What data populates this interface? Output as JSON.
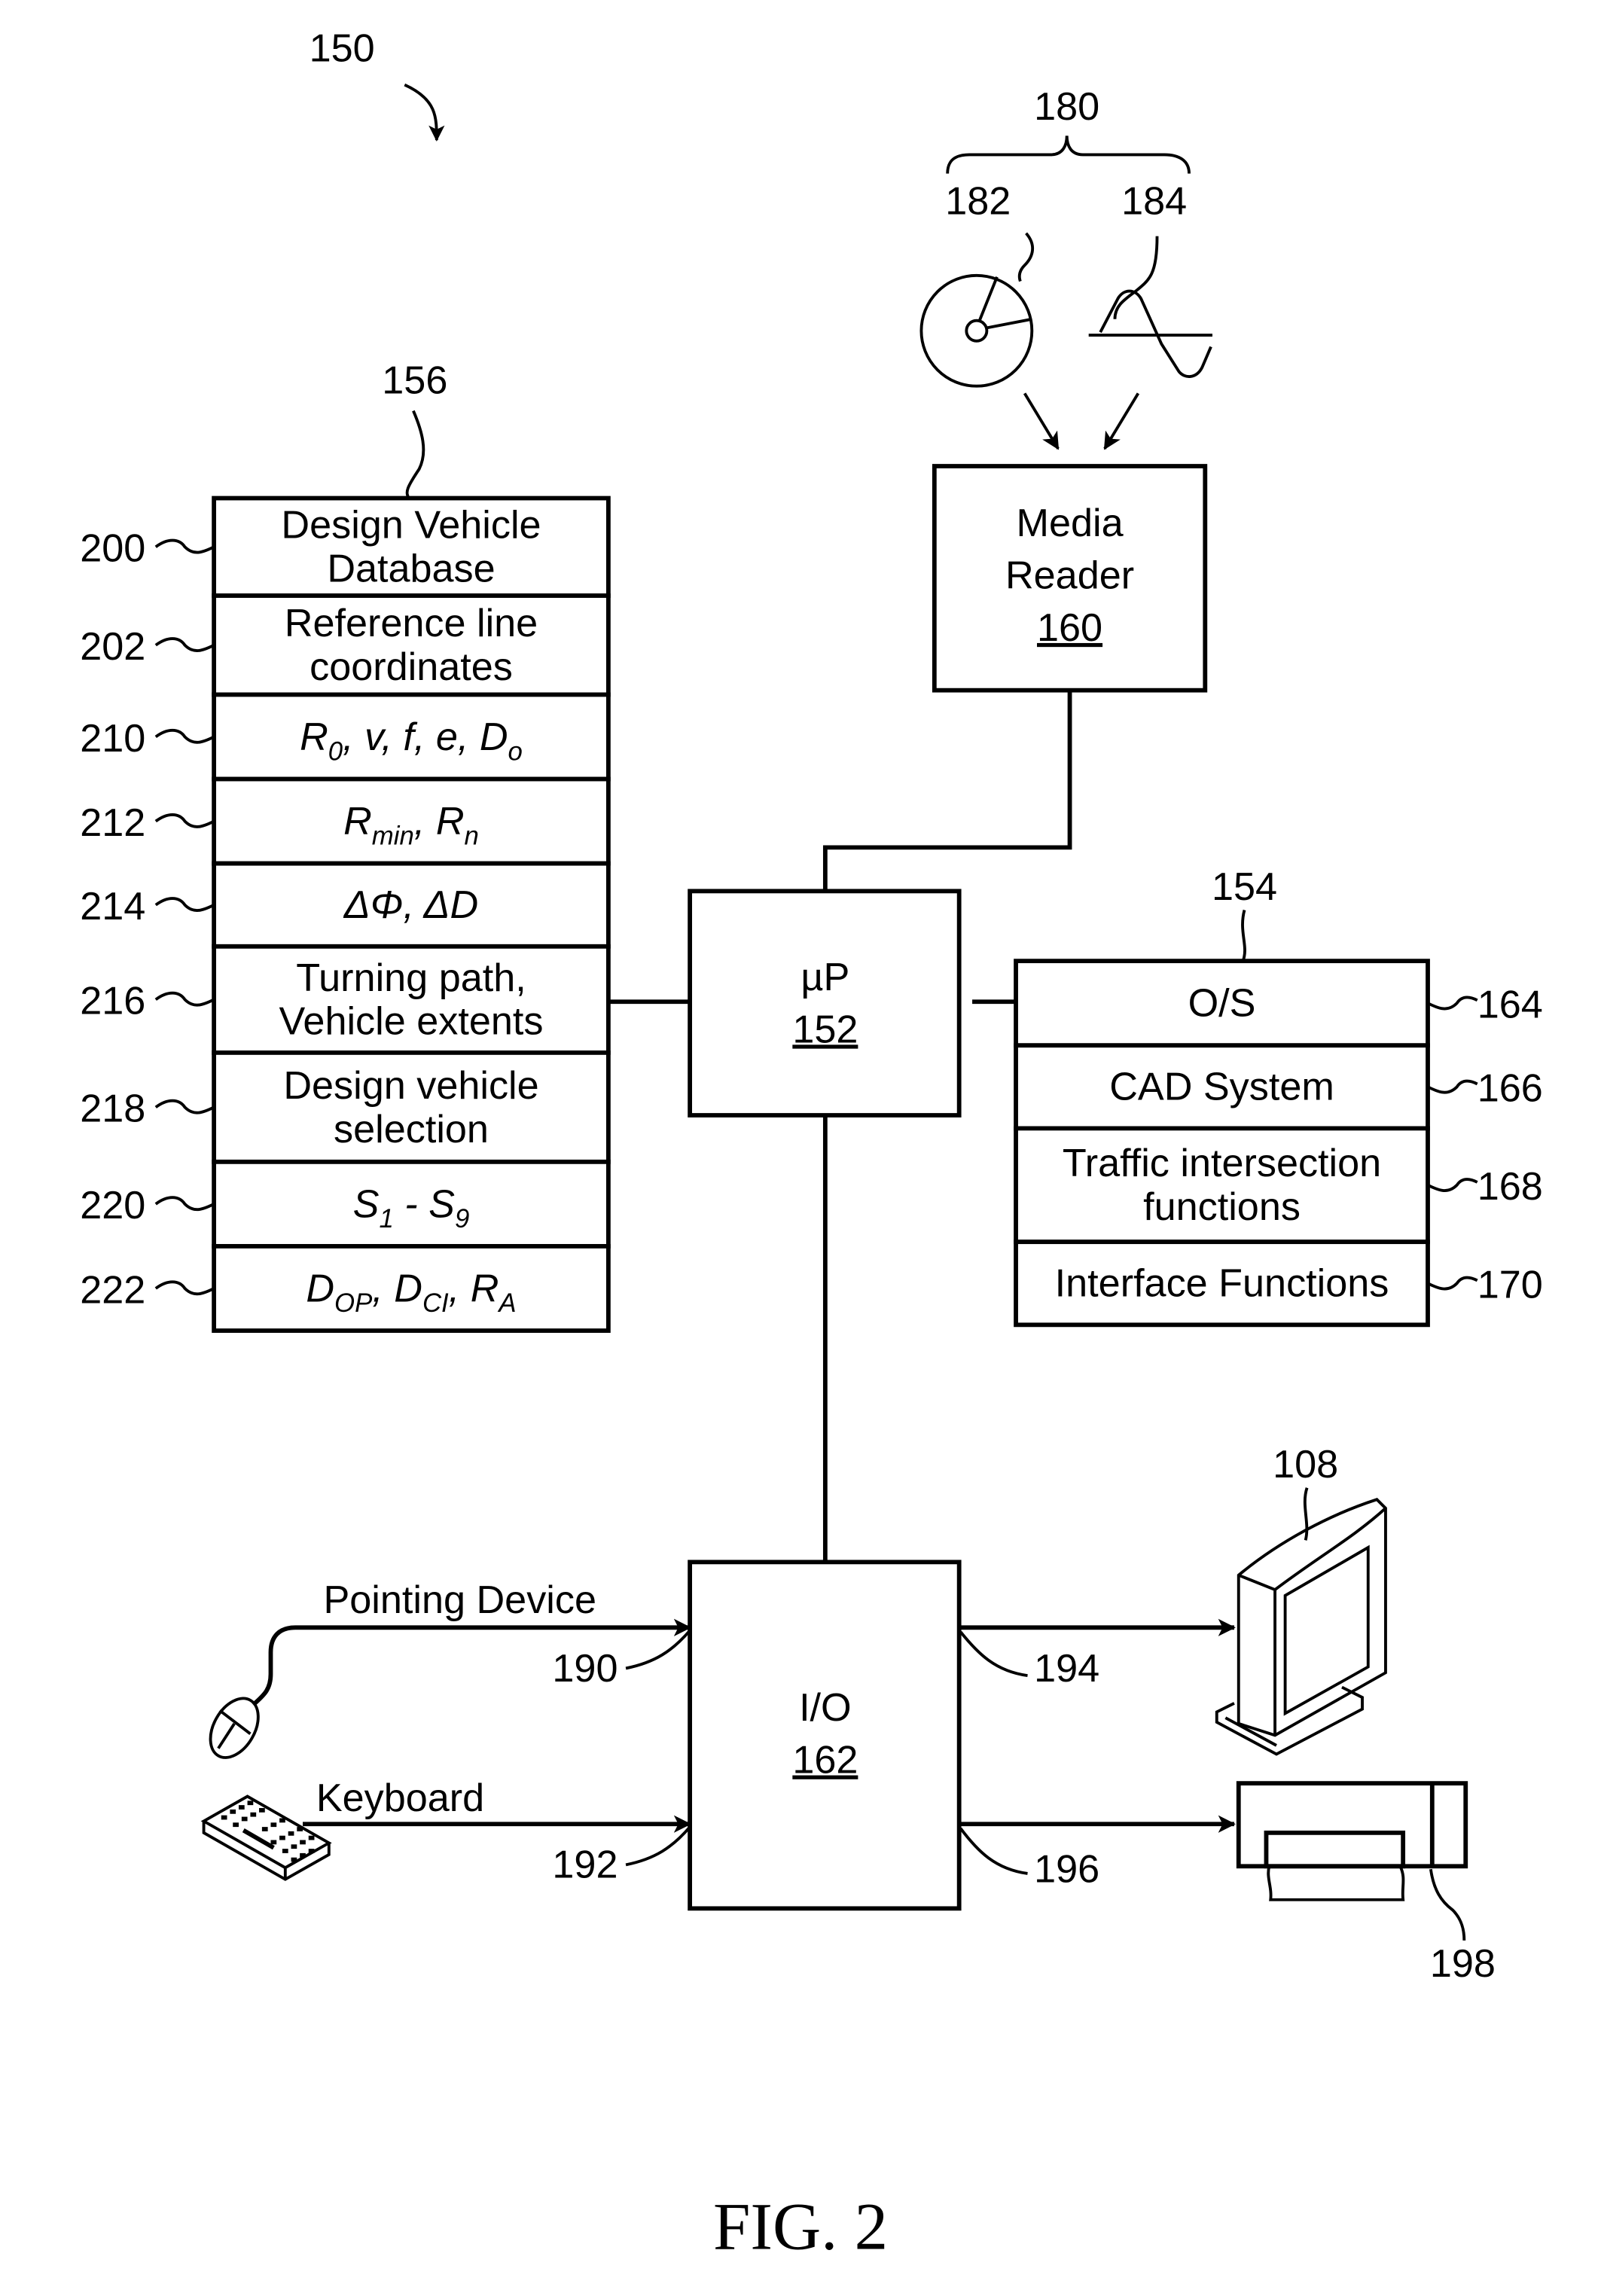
{
  "figure": {
    "ref_number": "150",
    "caption": "FIG. 2"
  },
  "media": {
    "group_ref": "180",
    "disc_ref": "182",
    "signal_ref": "184",
    "disc_icon": "disc-icon",
    "signal_icon": "sine-wave-icon"
  },
  "media_reader": {
    "line1": "Media",
    "line2": "Reader",
    "ref": "160"
  },
  "processor": {
    "label": "µP",
    "ref": "152"
  },
  "database": {
    "ref": "156",
    "rows": [
      {
        "ref": "200",
        "lines": [
          "Design Vehicle",
          "Database"
        ]
      },
      {
        "ref": "202",
        "lines": [
          "Reference line",
          "coordinates"
        ]
      },
      {
        "ref": "210",
        "formula": [
          [
            "R",
            "0"
          ],
          [
            ", v, f, e, ",
            ""
          ],
          [
            "D",
            "o"
          ]
        ]
      },
      {
        "ref": "212",
        "formula": [
          [
            "R",
            "min"
          ],
          [
            ", ",
            ""
          ],
          [
            "R",
            "n"
          ]
        ]
      },
      {
        "ref": "214",
        "formula": [
          [
            "ΔΦ, ΔD",
            ""
          ]
        ]
      },
      {
        "ref": "216",
        "lines": [
          "Turning path,",
          "Vehicle extents"
        ]
      },
      {
        "ref": "218",
        "lines": [
          "Design vehicle",
          "selection"
        ]
      },
      {
        "ref": "220",
        "formula": [
          [
            "S",
            "1"
          ],
          [
            " - ",
            ""
          ],
          [
            "S",
            "9"
          ]
        ]
      },
      {
        "ref": "222",
        "formula": [
          [
            "D",
            "OP"
          ],
          [
            ", ",
            ""
          ],
          [
            "D",
            "CI"
          ],
          [
            ", ",
            ""
          ],
          [
            "R",
            "A"
          ]
        ]
      }
    ]
  },
  "memory": {
    "ref": "154",
    "rows": [
      {
        "ref": "164",
        "lines": [
          "O/S"
        ]
      },
      {
        "ref": "166",
        "lines": [
          "CAD System"
        ]
      },
      {
        "ref": "168",
        "lines": [
          "Traffic intersection",
          "functions"
        ]
      },
      {
        "ref": "170",
        "lines": [
          "Interface Functions"
        ]
      }
    ]
  },
  "io": {
    "label": "I/O",
    "ref": "162",
    "inputs": [
      {
        "label": "Pointing Device",
        "ref": "190",
        "icon": "mouse-icon"
      },
      {
        "label": "Keyboard",
        "ref": "192",
        "icon": "keyboard-icon"
      }
    ],
    "outputs": [
      {
        "ref": "194",
        "device_ref": "108",
        "icon": "monitor-icon"
      },
      {
        "ref": "196",
        "device_ref": "198",
        "icon": "printer-icon"
      }
    ]
  }
}
